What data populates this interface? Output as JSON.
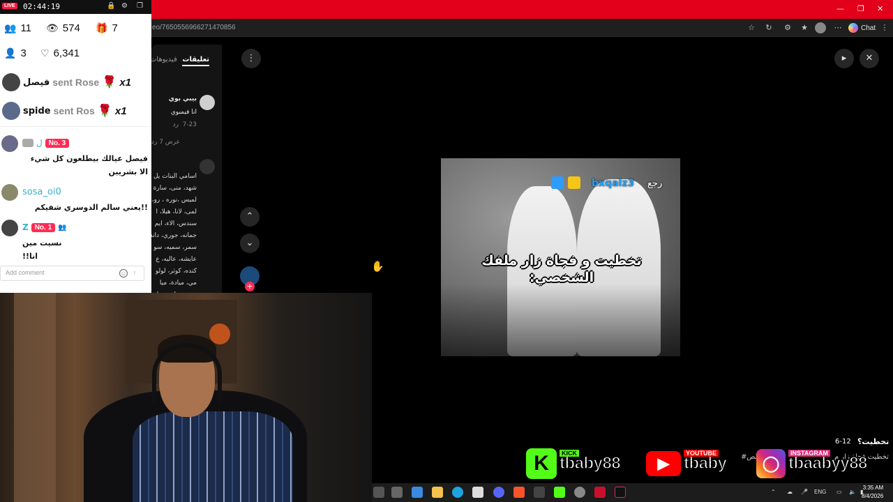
{
  "browser": {
    "url": "eo/7650556966271470856",
    "chat_label": "Chat",
    "window_controls": [
      "minimize-icon",
      "restore-icon",
      "close-icon"
    ]
  },
  "live_overlay": {
    "live_badge": "LIVE",
    "timer": "02:44:19",
    "stats": {
      "viewers_current": "11",
      "views": "574",
      "gifts": "7",
      "new_followers": "3",
      "likes": "6,341"
    },
    "gift_events": [
      {
        "user": "فيصل",
        "action": "sent Rose",
        "multiplier": "x1"
      },
      {
        "user": "spide",
        "action": "sent Ros",
        "multiplier": "x1"
      }
    ],
    "chat": [
      {
        "name": "ل",
        "rank": "No. 3",
        "message": "فيصل عيالك بيطلعون كل شيء الا بشريين"
      },
      {
        "name": "sosa_oi0",
        "rank": "",
        "message": "!!يعني سالم الدوسري شفيكم"
      },
      {
        "name": "Z",
        "rank": "No. 1",
        "message": "نسيت مين انا!!"
      }
    ],
    "add_comment_placeholder": "Add comment"
  },
  "comments_panel": {
    "tab_active": "تعليقات",
    "tab_inactive": "فيديوهات",
    "comment": {
      "user": "بيبي بوي",
      "text": "انا فيمبوي",
      "date": "7-23",
      "reply": "رد"
    },
    "view_replies": "عرض 7 ردود",
    "list_lines": [
      "اسامي البنات يل",
      "شهد، منى، سارة",
      "،لميس ،نوره ، رو",
      "لمى، لانا، هيلا، ا",
      "سندس، الاء، ايم",
      "جمانه، جوري، دانة",
      "سمر، سميه، سو",
      "عايشه، عاليه، ع",
      "كنده، كوثر، لولو",
      "مي، ميادة، ميا",
      "هدى، هناء، هيفا"
    ]
  },
  "video": {
    "username": "bxqalz3",
    "back_label": "رجع",
    "caption": "تخطيت و فجاة زار ملفك الشخصي:"
  },
  "video_meta": {
    "title": "تخطيت؟",
    "date": "6-12",
    "desc": "تخطيت فجاة زار م",
    "hashtag": "#شعب الص"
  },
  "socials": [
    {
      "platform": "KICK",
      "handle": "tbaby88",
      "color": "#53fc18"
    },
    {
      "platform": "YOUTUBE",
      "handle": "tbaby",
      "color": "#ff0000"
    },
    {
      "platform": "INSTAGRAM",
      "handle": "tbaabyy88",
      "color": "#d62976"
    }
  ],
  "taskbar": {
    "language": "ENG",
    "time": "3:35 AM",
    "date": "8/4/2026"
  }
}
